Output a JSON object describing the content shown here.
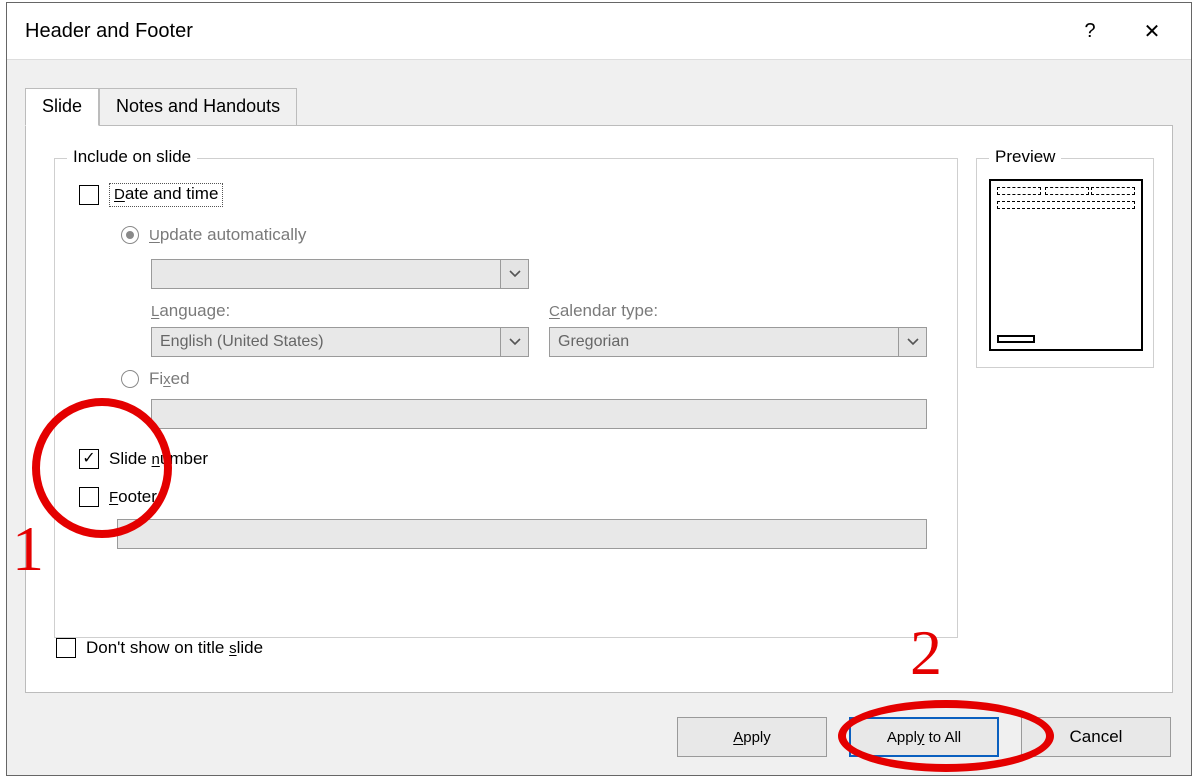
{
  "title": "Header and Footer",
  "help_icon": "?",
  "close_icon": "✕",
  "tabs": {
    "slide": "Slide",
    "notes": "Notes and Handouts"
  },
  "group": {
    "include": "Include on slide",
    "preview": "Preview"
  },
  "options": {
    "date_time": "Date and time",
    "update_auto": "Update automatically",
    "language_label": "Language:",
    "language_value": "English (United States)",
    "calendar_label": "Calendar type:",
    "calendar_value": "Gregorian",
    "fixed": "Fixed",
    "slide_number": "Slide number",
    "footer": "Footer",
    "dont_show": "Don't show on title slide"
  },
  "buttons": {
    "apply": "Apply",
    "apply_all": "Apply to All",
    "cancel": "Cancel"
  },
  "annotations": {
    "one": "1",
    "two": "2"
  }
}
